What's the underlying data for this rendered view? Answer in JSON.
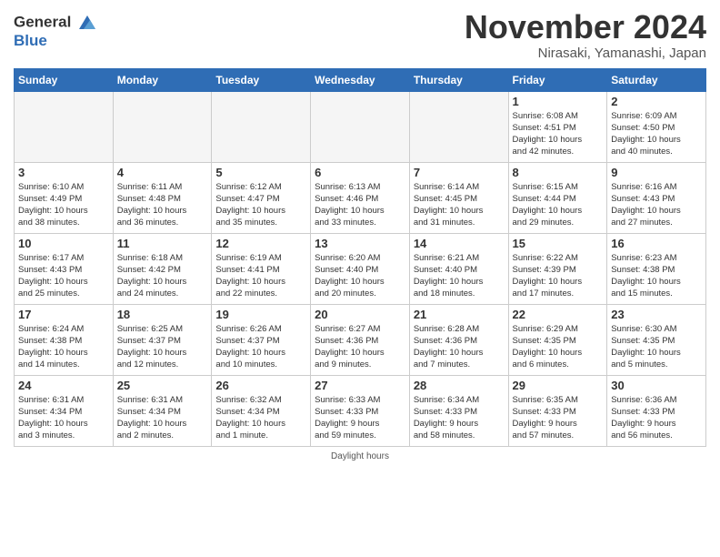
{
  "header": {
    "logo_line1": "General",
    "logo_line2": "Blue",
    "month": "November 2024",
    "location": "Nirasaki, Yamanashi, Japan"
  },
  "days_of_week": [
    "Sunday",
    "Monday",
    "Tuesday",
    "Wednesday",
    "Thursday",
    "Friday",
    "Saturday"
  ],
  "weeks": [
    [
      {
        "num": "",
        "info": ""
      },
      {
        "num": "",
        "info": ""
      },
      {
        "num": "",
        "info": ""
      },
      {
        "num": "",
        "info": ""
      },
      {
        "num": "",
        "info": ""
      },
      {
        "num": "1",
        "info": "Sunrise: 6:08 AM\nSunset: 4:51 PM\nDaylight: 10 hours\nand 42 minutes."
      },
      {
        "num": "2",
        "info": "Sunrise: 6:09 AM\nSunset: 4:50 PM\nDaylight: 10 hours\nand 40 minutes."
      }
    ],
    [
      {
        "num": "3",
        "info": "Sunrise: 6:10 AM\nSunset: 4:49 PM\nDaylight: 10 hours\nand 38 minutes."
      },
      {
        "num": "4",
        "info": "Sunrise: 6:11 AM\nSunset: 4:48 PM\nDaylight: 10 hours\nand 36 minutes."
      },
      {
        "num": "5",
        "info": "Sunrise: 6:12 AM\nSunset: 4:47 PM\nDaylight: 10 hours\nand 35 minutes."
      },
      {
        "num": "6",
        "info": "Sunrise: 6:13 AM\nSunset: 4:46 PM\nDaylight: 10 hours\nand 33 minutes."
      },
      {
        "num": "7",
        "info": "Sunrise: 6:14 AM\nSunset: 4:45 PM\nDaylight: 10 hours\nand 31 minutes."
      },
      {
        "num": "8",
        "info": "Sunrise: 6:15 AM\nSunset: 4:44 PM\nDaylight: 10 hours\nand 29 minutes."
      },
      {
        "num": "9",
        "info": "Sunrise: 6:16 AM\nSunset: 4:43 PM\nDaylight: 10 hours\nand 27 minutes."
      }
    ],
    [
      {
        "num": "10",
        "info": "Sunrise: 6:17 AM\nSunset: 4:43 PM\nDaylight: 10 hours\nand 25 minutes."
      },
      {
        "num": "11",
        "info": "Sunrise: 6:18 AM\nSunset: 4:42 PM\nDaylight: 10 hours\nand 24 minutes."
      },
      {
        "num": "12",
        "info": "Sunrise: 6:19 AM\nSunset: 4:41 PM\nDaylight: 10 hours\nand 22 minutes."
      },
      {
        "num": "13",
        "info": "Sunrise: 6:20 AM\nSunset: 4:40 PM\nDaylight: 10 hours\nand 20 minutes."
      },
      {
        "num": "14",
        "info": "Sunrise: 6:21 AM\nSunset: 4:40 PM\nDaylight: 10 hours\nand 18 minutes."
      },
      {
        "num": "15",
        "info": "Sunrise: 6:22 AM\nSunset: 4:39 PM\nDaylight: 10 hours\nand 17 minutes."
      },
      {
        "num": "16",
        "info": "Sunrise: 6:23 AM\nSunset: 4:38 PM\nDaylight: 10 hours\nand 15 minutes."
      }
    ],
    [
      {
        "num": "17",
        "info": "Sunrise: 6:24 AM\nSunset: 4:38 PM\nDaylight: 10 hours\nand 14 minutes."
      },
      {
        "num": "18",
        "info": "Sunrise: 6:25 AM\nSunset: 4:37 PM\nDaylight: 10 hours\nand 12 minutes."
      },
      {
        "num": "19",
        "info": "Sunrise: 6:26 AM\nSunset: 4:37 PM\nDaylight: 10 hours\nand 10 minutes."
      },
      {
        "num": "20",
        "info": "Sunrise: 6:27 AM\nSunset: 4:36 PM\nDaylight: 10 hours\nand 9 minutes."
      },
      {
        "num": "21",
        "info": "Sunrise: 6:28 AM\nSunset: 4:36 PM\nDaylight: 10 hours\nand 7 minutes."
      },
      {
        "num": "22",
        "info": "Sunrise: 6:29 AM\nSunset: 4:35 PM\nDaylight: 10 hours\nand 6 minutes."
      },
      {
        "num": "23",
        "info": "Sunrise: 6:30 AM\nSunset: 4:35 PM\nDaylight: 10 hours\nand 5 minutes."
      }
    ],
    [
      {
        "num": "24",
        "info": "Sunrise: 6:31 AM\nSunset: 4:34 PM\nDaylight: 10 hours\nand 3 minutes."
      },
      {
        "num": "25",
        "info": "Sunrise: 6:31 AM\nSunset: 4:34 PM\nDaylight: 10 hours\nand 2 minutes."
      },
      {
        "num": "26",
        "info": "Sunrise: 6:32 AM\nSunset: 4:34 PM\nDaylight: 10 hours\nand 1 minute."
      },
      {
        "num": "27",
        "info": "Sunrise: 6:33 AM\nSunset: 4:33 PM\nDaylight: 9 hours\nand 59 minutes."
      },
      {
        "num": "28",
        "info": "Sunrise: 6:34 AM\nSunset: 4:33 PM\nDaylight: 9 hours\nand 58 minutes."
      },
      {
        "num": "29",
        "info": "Sunrise: 6:35 AM\nSunset: 4:33 PM\nDaylight: 9 hours\nand 57 minutes."
      },
      {
        "num": "30",
        "info": "Sunrise: 6:36 AM\nSunset: 4:33 PM\nDaylight: 9 hours\nand 56 minutes."
      }
    ]
  ],
  "footer": {
    "daylight_hours": "Daylight hours"
  }
}
